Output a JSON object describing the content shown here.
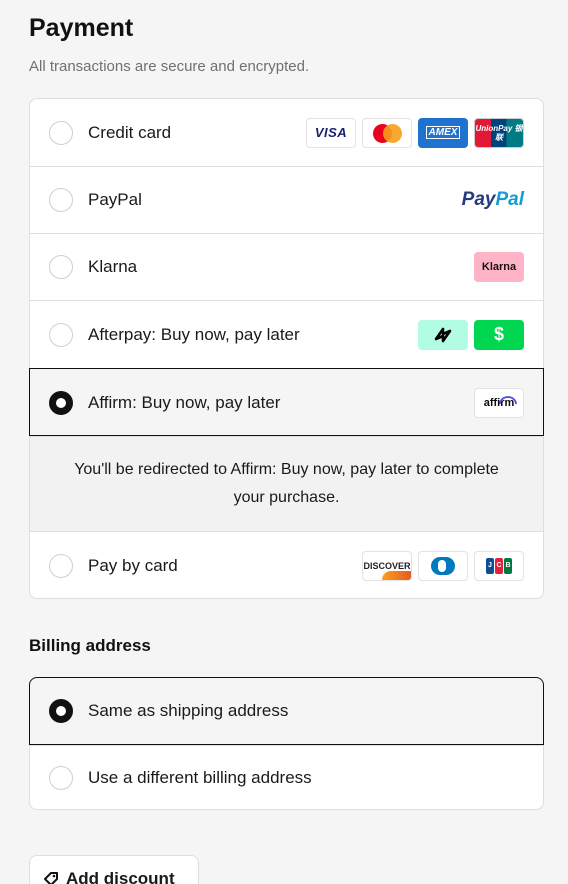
{
  "payment": {
    "title": "Payment",
    "subtitle": "All transactions are secure and encrypted.",
    "options": [
      {
        "label": "Credit card",
        "selected": false,
        "logos": [
          "VISA",
          "mastercard",
          "AMEX",
          "UnionPay 银联"
        ]
      },
      {
        "label": "PayPal",
        "selected": false,
        "logos": [
          "PayPal"
        ]
      },
      {
        "label": "Klarna",
        "selected": false,
        "logos": [
          "Klarna"
        ]
      },
      {
        "label": "Afterpay: Buy now, pay later",
        "selected": false,
        "logos": [
          "afterpay-link",
          "cash-app"
        ]
      },
      {
        "label": "Affirm: Buy now, pay later",
        "selected": true,
        "logos": [
          "affirm"
        ]
      },
      {
        "label": "Pay by card",
        "selected": false,
        "logos": [
          "DISCOVER",
          "diners",
          "JCB"
        ]
      }
    ],
    "redirect_message": "You'll be redirected to Affirm: Buy now, pay later to complete your purchase.",
    "logo_text": {
      "visa": "VISA",
      "amex": "AMEX",
      "unionpay": "UnionPay 银联",
      "paypal_a": "Pay",
      "paypal_b": "Pal",
      "klarna": "Klarna",
      "cashapp": "$",
      "affirm": "affirm",
      "discover": "DISCOVER",
      "jcb_j": "J",
      "jcb_c": "C",
      "jcb_b": "B"
    }
  },
  "billing": {
    "title": "Billing address",
    "options": [
      {
        "label": "Same as shipping address",
        "selected": true
      },
      {
        "label": "Use a different billing address",
        "selected": false
      }
    ]
  },
  "discount": {
    "label": "Add discount"
  },
  "colors": {
    "accent": "#111111",
    "border": "#dedede",
    "muted_text": "#707070"
  }
}
